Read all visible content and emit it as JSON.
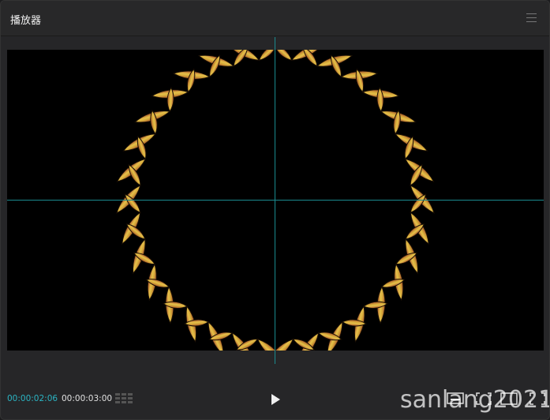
{
  "panel": {
    "title": "播放器"
  },
  "player": {
    "current_time": "00:00:02:06",
    "total_time": "00:00:03:00"
  },
  "watermark": "sanlang2021",
  "colors": {
    "guide": "#1a8a8e",
    "time_current": "#2bb4c3",
    "wreath_top": "#a8502a",
    "wreath_mid": "#d4a63a",
    "wreath_light": "#e6c24a"
  },
  "icons": [
    "menu-icon",
    "waveform-grid-icon",
    "play-icon",
    "subtitle-icon",
    "aspect-ratio-icon",
    "fullscreen-icon"
  ]
}
